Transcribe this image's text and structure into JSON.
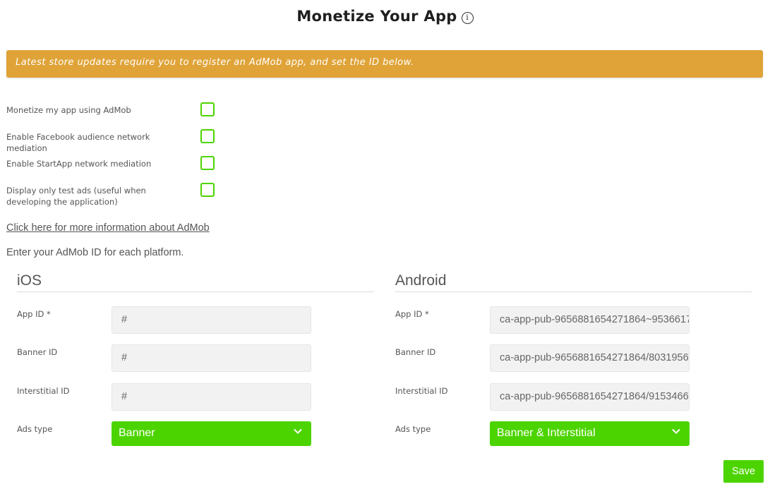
{
  "header": {
    "title": "Monetize Your App",
    "info_glyph": "i"
  },
  "notice": {
    "text": "Latest store updates require you to register an AdMob app, and set the ID below."
  },
  "options": [
    {
      "label": "Monetize my app using AdMob",
      "checked": false
    },
    {
      "label": "Enable Facebook audience network mediation",
      "checked": false
    },
    {
      "label": "Enable StartApp network mediation",
      "checked": false
    },
    {
      "label": "Display only test ads (useful when developing the application)",
      "checked": false
    }
  ],
  "info_link": "Click here for more information about AdMob",
  "intro": "Enter your AdMob ID for each platform.",
  "ios": {
    "title": "iOS",
    "app_id_label": "App ID *",
    "app_id_value": "#",
    "banner_id_label": "Banner ID",
    "banner_id_value": "#",
    "interstitial_id_label": "Interstitial ID",
    "interstitial_id_value": "#",
    "ads_type_label": "Ads type",
    "ads_type_value": "Banner"
  },
  "android": {
    "title": "Android",
    "app_id_label": "App ID *",
    "app_id_value": "ca-app-pub-9656881654271864~9536617",
    "banner_id_label": "Banner ID",
    "banner_id_value": "ca-app-pub-9656881654271864/8031956",
    "interstitial_id_label": "Interstitial ID",
    "interstitial_id_value": "ca-app-pub-9656881654271864/9153466",
    "ads_type_label": "Ads type",
    "ads_type_value": "Banner & Interstitial"
  },
  "save_label": "Save",
  "colors": {
    "accent_green": "#4cd400",
    "notice_orange": "#dfa337",
    "input_bg": "#f2f2f2"
  }
}
